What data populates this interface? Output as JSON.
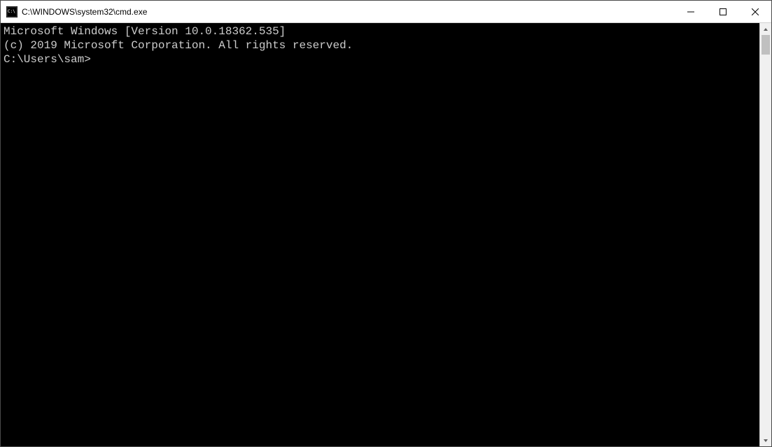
{
  "titlebar": {
    "title": "C:\\WINDOWS\\system32\\cmd.exe"
  },
  "terminal": {
    "line1": "Microsoft Windows [Version 10.0.18362.535]",
    "line2": "(c) 2019 Microsoft Corporation. All rights reserved.",
    "blank": "",
    "prompt": "C:\\Users\\sam>"
  }
}
